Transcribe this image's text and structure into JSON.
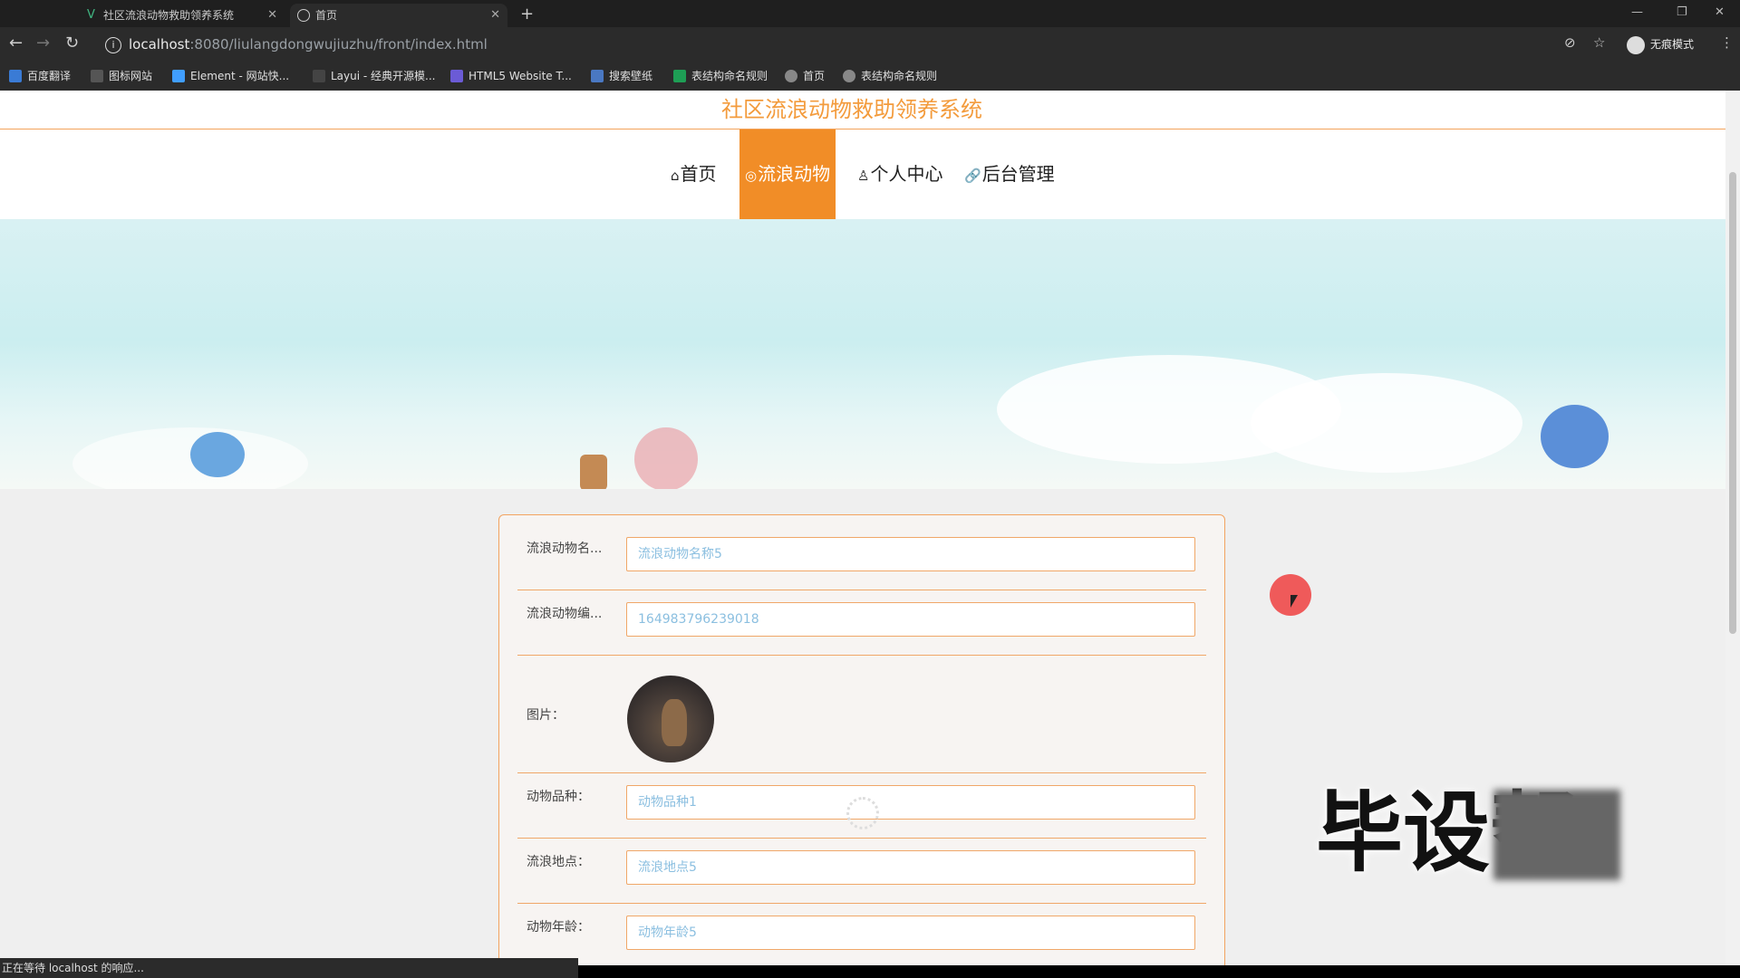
{
  "browser": {
    "tabs": [
      {
        "title": "社区流浪动物救助领养系统"
      },
      {
        "title": "首页"
      }
    ],
    "new_tab": "+",
    "url_host": "localhost",
    "url_path": ":8080/liulangdongwujiuzhu/front/index.html",
    "incognito_label": "无痕模式",
    "bookmarks": [
      "百度翻译",
      "图标网站",
      "Element - 网站快...",
      "Layui - 经典开源模...",
      "HTML5 Website T...",
      "搜索壁纸",
      "表结构命名规则",
      "首页",
      "表结构命名规则"
    ],
    "status_text": "正在等待 localhost 的响应..."
  },
  "site": {
    "title": "社区流浪动物救助领养系统",
    "nav": [
      {
        "label": "首页",
        "icon": "home-icon"
      },
      {
        "label": "流浪动物",
        "icon": "pet-icon"
      },
      {
        "label": "个人中心",
        "icon": "user-icon"
      },
      {
        "label": "后台管理",
        "icon": "link-icon"
      }
    ],
    "active_nav": "流浪动物",
    "carousel_slides": 3,
    "carousel_active": 1
  },
  "form": {
    "rows": [
      {
        "label": "流浪动物名...",
        "value": "流浪动物名称5"
      },
      {
        "label": "流浪动物编...",
        "value": "164983796239018"
      },
      {
        "label": "图片：",
        "value": ""
      },
      {
        "label": "动物品种：",
        "value": "动物品种1"
      },
      {
        "label": "流浪地点：",
        "value": "流浪地点5"
      },
      {
        "label": "动物年龄：",
        "value": "动物年龄5"
      }
    ]
  },
  "overlay": {
    "watermark": "毕设帮"
  },
  "colors": {
    "accent": "#f18d27",
    "title": "#f39b3c",
    "border": "#f0a768",
    "input_text": "#8bbfe0"
  }
}
